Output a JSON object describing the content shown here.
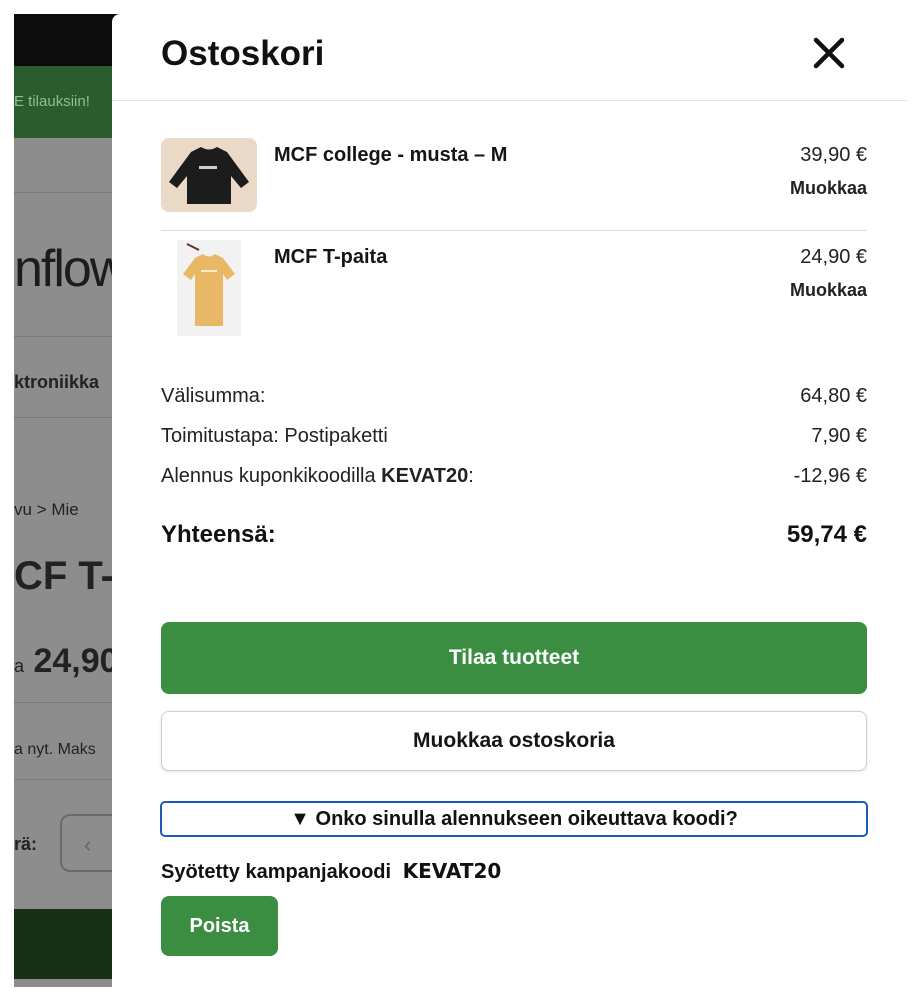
{
  "background_page": {
    "promo_text": "E tilauksiin!",
    "logo_fragment": "nflow",
    "nav_fragment": "ktroniikka",
    "breadcrumb_fragment": "vu  >  Mie",
    "title_fragment": "CF T-p",
    "price_fragment_prefix": "a",
    "price_fragment": "24,90",
    "note_fragment": "a nyt. Maks",
    "qty_label_fragment": "rä:",
    "stepper_icon": "chevron-left-icon"
  },
  "cart": {
    "title": "Ostoskori",
    "close_icon": "close-icon",
    "items": [
      {
        "name": "MCF college - musta – M",
        "price": "39,90 €",
        "edit_label": "Muokkaa",
        "image": "black-sweatshirt-image"
      },
      {
        "name": "MCF T-paita",
        "price": "24,90 €",
        "edit_label": "Muokkaa",
        "image": "yellow-tshirt-image"
      }
    ],
    "summary": {
      "subtotal_label": "Välisumma:",
      "subtotal_value": "64,80 €",
      "shipping_label": "Toimitustapa: Postipaketti",
      "shipping_value": "7,90 €",
      "discount_label_prefix": "Alennus kuponkikoodilla ",
      "discount_code": "KEVAT20",
      "discount_label_suffix": ":",
      "discount_value": "-12,96 €",
      "total_label": "Yhteensä:",
      "total_value": "59,74 €"
    },
    "order_button": "Tilaa tuotteet",
    "edit_cart_button": "Muokkaa ostoskoria",
    "coupon_toggle": "▼ Onko sinulla alennukseen oikeuttava koodi?",
    "coupon_applied_label": "Syötetty kampanjakoodi",
    "coupon_applied_code": "KEVAT20",
    "remove_button": "Poista"
  },
  "colors": {
    "primary_green": "#3b8d42",
    "focus_blue": "#1e5bb8",
    "overlay_gray": "#8d8d8d"
  }
}
